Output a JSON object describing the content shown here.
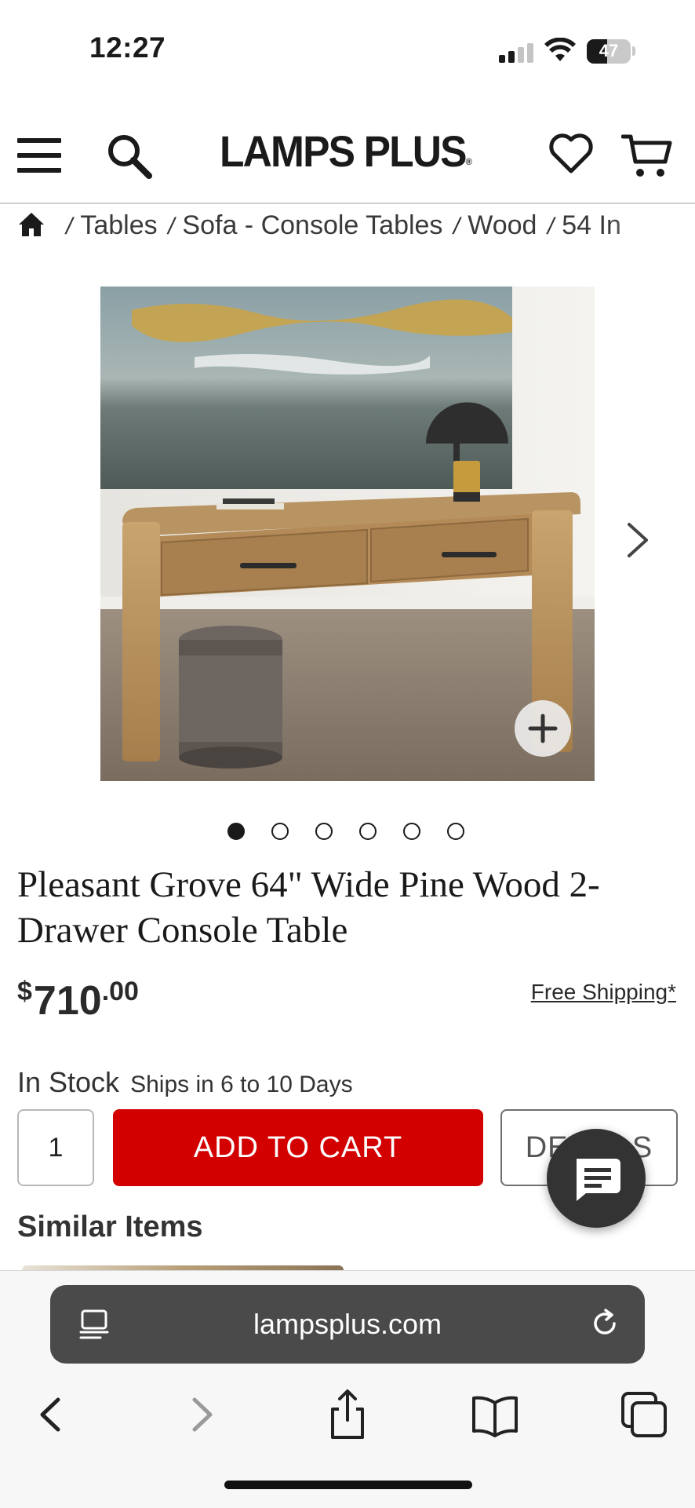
{
  "status_bar": {
    "time": "12:27",
    "battery": "47",
    "battery_level": 0.47
  },
  "header": {
    "logo": "LAMPS PLUS",
    "icons": [
      "menu-icon",
      "search-icon",
      "heart-icon",
      "cart-icon"
    ]
  },
  "breadcrumb": {
    "items": [
      "Tables",
      "Sofa - Console Tables",
      "Wood",
      "54 In"
    ]
  },
  "gallery": {
    "image_count": 6,
    "active_index": 0
  },
  "product": {
    "title": "Pleasant Grove 64\" Wide Pine Wood 2-Drawer Console Table",
    "price_currency": "$",
    "price_dollars": "710",
    "price_cents": ".00",
    "shipping": "Free Shipping*",
    "stock": "In Stock",
    "ships": "Ships in 6 to 10 Days",
    "quantity": "1",
    "add_to_cart": "ADD TO CART",
    "details": "DETAILS"
  },
  "similar": {
    "heading": "Similar Items"
  },
  "browser": {
    "url": "lampsplus.com"
  },
  "colors": {
    "accent_red": "#d30000",
    "chat_button": "#333333",
    "url_bar": "#4a4a4a"
  }
}
